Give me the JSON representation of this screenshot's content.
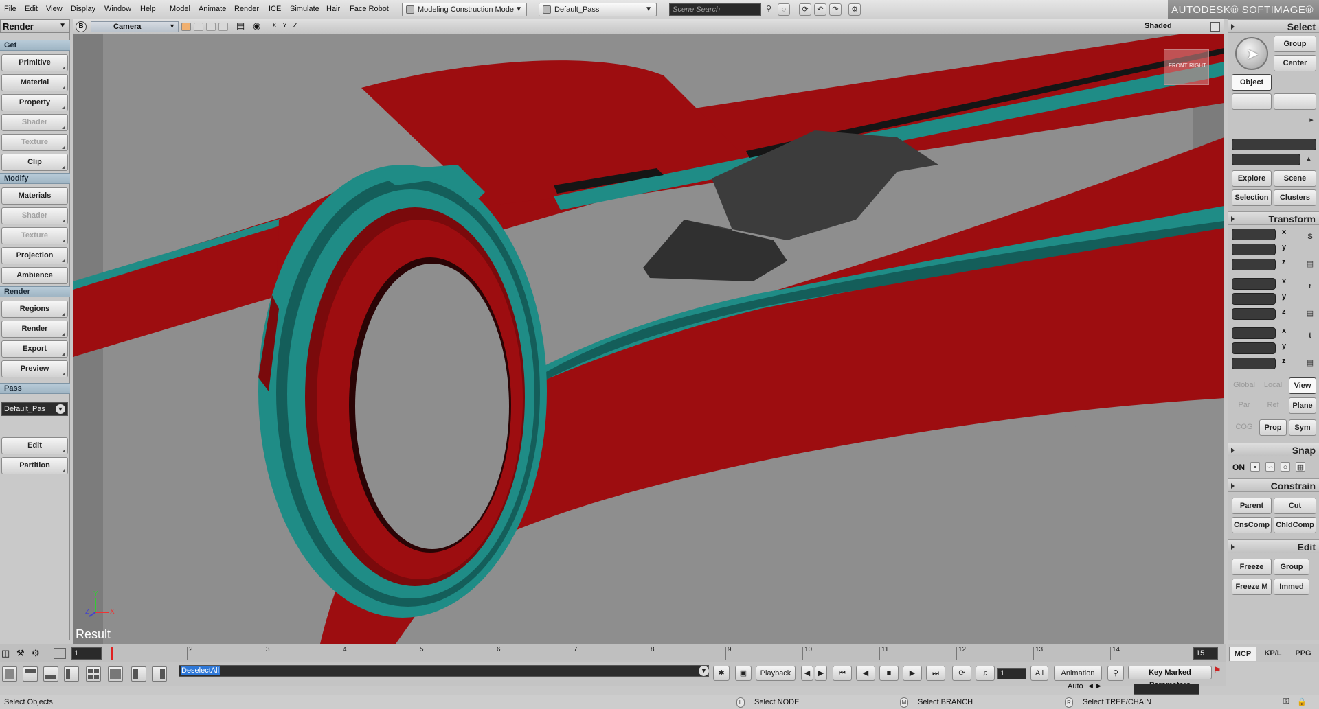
{
  "menubar": {
    "items": [
      "File",
      "Edit",
      "View",
      "Display",
      "Window",
      "Help",
      "Model",
      "Animate",
      "Render",
      "ICE",
      "Simulate",
      "Hair",
      "Face Robot"
    ],
    "mode_combo": "Modeling Construction Mode",
    "pass_combo": "Default_Pass",
    "search_placeholder": "Scene Search",
    "brand": "AUTODESK® SOFTIMAGE®"
  },
  "left_panel": {
    "title": "Render",
    "sections": {
      "get": "Get",
      "modify": "Modify",
      "render": "Render",
      "pass": "Pass"
    },
    "get_buttons": [
      "Primitive",
      "Material",
      "Property",
      "Shader",
      "Texture",
      "Clip"
    ],
    "modify_buttons": [
      "Materials",
      "Shader",
      "Texture",
      "Projection",
      "Ambience"
    ],
    "render_buttons": [
      "Regions",
      "Render",
      "Export",
      "Preview"
    ],
    "pass_value": "Default_Pas",
    "pass_buttons": [
      "Edit",
      "Partition"
    ]
  },
  "viewport": {
    "letter": "B",
    "camera": "Camera",
    "axes_label": "X Y Z",
    "display_mode": "Shaded",
    "result_label": "Result",
    "nav_cube": {
      "front": "FRONT",
      "right": "RIGHT"
    },
    "gizmo": {
      "x": "X",
      "y": "Y",
      "z": "Z"
    },
    "colors": {
      "background": "#8c8c8c",
      "red": "#9d0d10",
      "red_dark": "#7a0a0c",
      "teal": "#1f8c86",
      "teal_dark": "#145e5a",
      "grey_block": "#3c3c3c"
    }
  },
  "right_panel": {
    "select_title": "Select",
    "group_label": "Group",
    "center_label": "Center",
    "object_label": "Object",
    "explore_label": "Explore",
    "scene_label": "Scene",
    "selection_label": "Selection",
    "clusters_label": "Clusters",
    "transform_title": "Transform",
    "axes": [
      "x",
      "y",
      "z"
    ],
    "transform_icons": [
      "S",
      "r",
      "t"
    ],
    "ref_row1": [
      "Global",
      "Local",
      "View"
    ],
    "ref_row2": [
      "Par",
      "Ref",
      "Plane"
    ],
    "ref_row3": [
      "COG",
      "Prop",
      "Sym"
    ],
    "snap_title": "Snap",
    "snap_on": "ON",
    "constrain_title": "Constrain",
    "constrain_buttons": [
      "Parent",
      "Cut",
      "CnsComp",
      "ChldComp"
    ],
    "edit_title": "Edit",
    "edit_buttons": [
      "Freeze",
      "Group",
      "Freeze M",
      "Immed"
    ]
  },
  "timeline": {
    "start_frame": "1",
    "end_frame": "15",
    "ticks": [
      "2",
      "3",
      "4",
      "5",
      "6",
      "7",
      "8",
      "9",
      "10",
      "11",
      "12",
      "13",
      "14"
    ]
  },
  "command_bar": {
    "command": "DeselectAll",
    "playback_label": "Playback",
    "current_frame": "1",
    "all_label": "All",
    "animation_label": "Animation",
    "auto_label": "Auto",
    "key_params_label": "Key Marked Parameters"
  },
  "right_tabs": [
    "MCP",
    "KP/L",
    "PPG"
  ],
  "status_bar": {
    "message": "Select Objects",
    "left_button": {
      "key": "L",
      "text": "Select NODE"
    },
    "middle_button": {
      "key": "M",
      "text": "Select BRANCH"
    },
    "right_button": {
      "key": "R",
      "text": "Select TREE/CHAIN"
    }
  }
}
